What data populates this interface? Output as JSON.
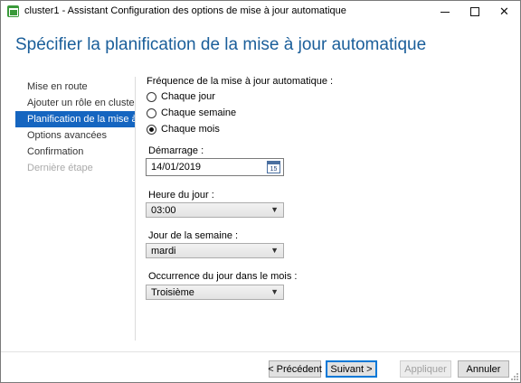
{
  "window": {
    "title": "cluster1 - Assistant Configuration des options de mise à jour automatique",
    "minimize_label": "",
    "maximize_label": "",
    "close_label": "✕"
  },
  "header": {
    "title": "Spécifier la planification de la mise à jour automatique"
  },
  "nav": {
    "items": [
      {
        "label": "Mise en route",
        "state": "normal"
      },
      {
        "label": "Ajouter un rôle en cluster",
        "state": "normal"
      },
      {
        "label": "Planification de la mise à j...",
        "state": "active"
      },
      {
        "label": "Options avancées",
        "state": "normal"
      },
      {
        "label": "Confirmation",
        "state": "normal"
      },
      {
        "label": "Dernière étape",
        "state": "disabled"
      }
    ]
  },
  "form": {
    "frequency_label": "Fréquence de la mise à jour automatique :",
    "frequency_options": [
      {
        "label": "Chaque jour",
        "checked": false
      },
      {
        "label": "Chaque semaine",
        "checked": false
      },
      {
        "label": "Chaque mois",
        "checked": true
      }
    ],
    "start_label": "Démarrage :",
    "start_value": "14/01/2019",
    "calendar_icon_text": "15",
    "time_label": "Heure du jour :",
    "time_value": "03:00",
    "weekday_label": "Jour de la semaine :",
    "weekday_value": "mardi",
    "occurrence_label": "Occurrence du jour dans le mois :",
    "occurrence_value": "Troisième"
  },
  "buttons": {
    "previous": "< Précédent",
    "next": "Suivant >",
    "apply": "Appliquer",
    "cancel": "Annuler"
  },
  "colors": {
    "accent": "#1565c0",
    "header_text": "#1a5e9a",
    "app_icon": "#3a9a3a"
  },
  "icons": {
    "app": "cluster-update-icon",
    "calendar": "calendar-icon",
    "dropdown": "chevron-down-icon"
  }
}
